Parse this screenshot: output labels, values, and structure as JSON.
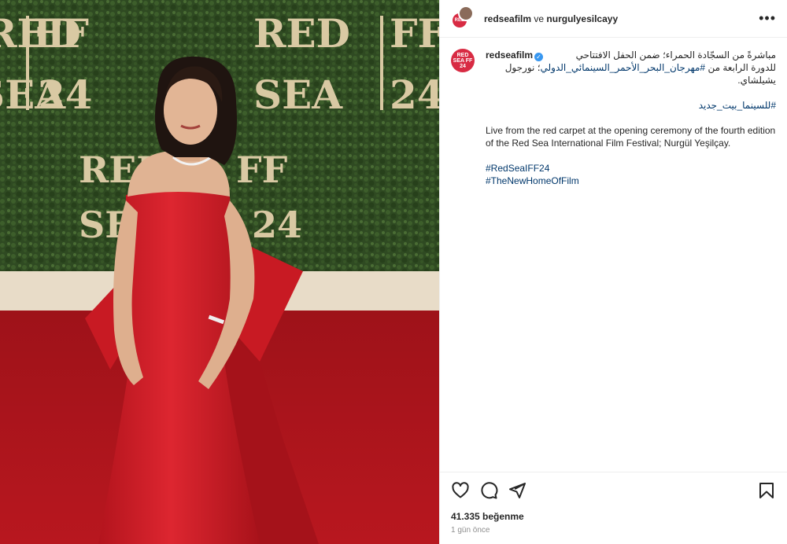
{
  "header": {
    "account_1": "redseafilm",
    "connector": "ve",
    "account_2": "nurgulyesilcayy",
    "more_icon": "more-horizontal-icon"
  },
  "brand_avatar": {
    "line1": "RED",
    "line2": "SEA FF",
    "line3": "24",
    "color": "#d82b43"
  },
  "caption": {
    "username": "redseafilm",
    "verified_icon": "verified-badge-icon",
    "arabic_line1": "مباشرةً من السجّادة الحمراء؛ ضمن الحفل الافتتاحي",
    "arabic_line2_prefix": "للدورة الرابعة من",
    "arabic_line2_link": "#مهرجان_البحر_الأحمر_السينمائي_الدولي",
    "arabic_line2_suffix": "؛ نورجول",
    "arabic_line3": "يشيلشاي.",
    "arabic_hashtag": "#للسينما_بيت_جديد",
    "english_text": "Live from the red carpet at the opening ceremony of the fourth edition of the Red Sea International Film Festival; Nurgül Yeşilçay.",
    "hashtag_1": "#RedSeaIFF24",
    "hashtag_2": "#TheNewHomeOfFilm"
  },
  "actions": {
    "like_icon": "heart-icon",
    "comment_icon": "comment-icon",
    "share_icon": "send-icon",
    "save_icon": "bookmark-icon"
  },
  "stats": {
    "likes_count": "41.335",
    "likes_label": "beğenme",
    "timestamp": "1 gün önce"
  },
  "photo": {
    "backdrop": {
      "row1": [
        "RED",
        "FF",
        "SEA",
        "24"
      ],
      "row2": [
        "RED",
        "FF",
        "SEA",
        "24"
      ]
    },
    "colors": {
      "carpet": "#b3141d",
      "foliage": "#2f4a22",
      "dress": "#d21d26",
      "gold": "#d9c9a3"
    }
  }
}
